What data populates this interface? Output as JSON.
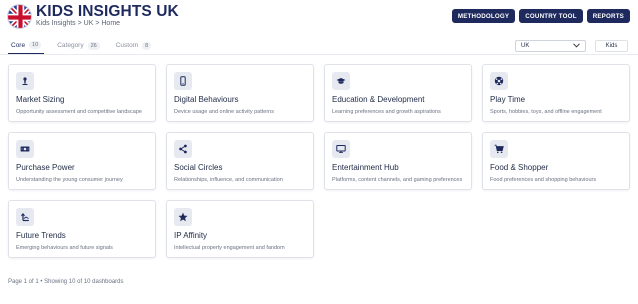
{
  "header": {
    "title": "KIDS INSIGHTS UK",
    "breadcrumb": "Kids Insights > UK > Home",
    "buttons": [
      "METHODOLOGY",
      "COUNTRY TOOL",
      "REPORTS"
    ]
  },
  "tabs": [
    {
      "label": "Core",
      "count": "10",
      "active": true
    },
    {
      "label": "Category",
      "count": "26",
      "active": false
    },
    {
      "label": "Custom",
      "count": "8",
      "active": false
    }
  ],
  "filters": {
    "country_selected": "UK",
    "audience_button": "Kids"
  },
  "cards": [
    {
      "title": "Market Sizing",
      "desc": "Opportunity assessment and competitive landscape",
      "icon": "person-pin-icon"
    },
    {
      "title": "Digital Behaviours",
      "desc": "Device usage and online activity patterns",
      "icon": "mobile-phone-icon"
    },
    {
      "title": "Education & Development",
      "desc": "Learning preferences and growth aspirations",
      "icon": "graduation-cap-icon"
    },
    {
      "title": "Play Time",
      "desc": "Sports, hobbies, toys, and offline engagement",
      "icon": "football-icon"
    },
    {
      "title": "Purchase Power",
      "desc": "Understanding the young consumer journey",
      "icon": "money-icon"
    },
    {
      "title": "Social Circles",
      "desc": "Relationships, influence, and communication",
      "icon": "share-nodes-icon"
    },
    {
      "title": "Entertainment Hub",
      "desc": "Platforms, content channels, and gaming preferences",
      "icon": "monitor-icon"
    },
    {
      "title": "Food & Shopper",
      "desc": "Food preferences and shopping behaviours",
      "icon": "shopping-cart-icon"
    },
    {
      "title": "Future Trends",
      "desc": "Emerging behaviours and future signals",
      "icon": "trend-arrow-icon"
    },
    {
      "title": "IP Affinity",
      "desc": "Intellectual property engagement and fandom",
      "icon": "star-icon"
    }
  ],
  "footer": {
    "pagination": "Page 1 of 1 • Showing 10 of 10 dashboards"
  },
  "colors": {
    "brand": "#1e2a5e",
    "icon_bg": "#e7e9f1",
    "muted_text": "#6b7283"
  }
}
